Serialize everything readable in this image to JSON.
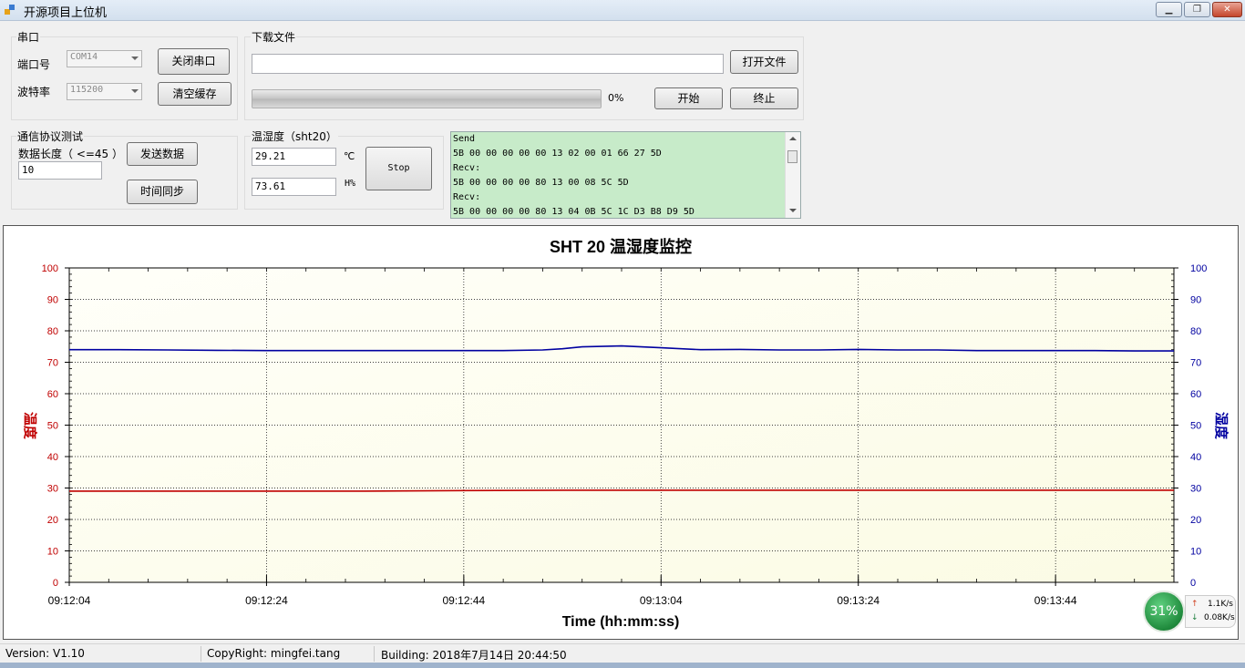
{
  "window": {
    "title": "开源项目上位机"
  },
  "serial": {
    "group_label": "串口",
    "port_label": "端口号",
    "port_value": "COM14",
    "baud_label": "波特率",
    "baud_value": "115200",
    "close_button": "关闭串口",
    "clear_button": "清空缓存"
  },
  "download": {
    "group_label": "下载文件",
    "file_path": "",
    "open_button": "打开文件",
    "progress_text": "0%",
    "progress_value": 0,
    "start_button": "开始",
    "stop_button": "终止"
  },
  "protocol": {
    "group_label": "通信协议测试",
    "length_label": "数据长度（ <=45 ）",
    "length_value": "10",
    "send_button": "发送数据",
    "sync_button": "时间同步"
  },
  "sensor": {
    "group_label": "温湿度（sht20）",
    "temperature": "29.21",
    "temp_unit": "℃",
    "humidity": "73.61",
    "hum_unit": "H%",
    "stop_button": "Stop"
  },
  "log": {
    "lines": [
      "Send",
      "5B 00 00 00 00 00 13 02 00 01 66 27 5D",
      "Recv:",
      "5B 00 00 00 00 80 13 00 08 5C 5D",
      "Recv:",
      "5B 00 00 00 00 80 13 04 0B 5C 1C D3 B8 D9 5D"
    ]
  },
  "chart_data": {
    "type": "line",
    "title": "SHT 20 温湿度监控",
    "xlabel": "Time (hh:mm:ss)",
    "ylabel": "温度",
    "y2label": "湿度",
    "ylim": [
      0,
      100
    ],
    "y2lim": [
      0,
      100
    ],
    "yticks": [
      0,
      10,
      20,
      30,
      40,
      50,
      60,
      70,
      80,
      90,
      100
    ],
    "xticks": [
      "09:12:04",
      "09:12:24",
      "09:12:44",
      "09:13:04",
      "09:13:24",
      "09:13:44"
    ],
    "xlim_seconds": [
      0,
      112
    ],
    "grid": true,
    "series": [
      {
        "axis": "left",
        "color": "#c00000",
        "x": [
          0,
          10,
          20,
          30,
          40,
          50,
          60,
          70,
          80,
          90,
          100,
          112
        ],
        "values": [
          29.0,
          29.0,
          29.0,
          29.0,
          29.2,
          29.3,
          29.3,
          29.3,
          29.3,
          29.3,
          29.3,
          29.3
        ]
      },
      {
        "axis": "right",
        "color": "#0000a0",
        "x": [
          0,
          5,
          10,
          15,
          20,
          25,
          30,
          35,
          40,
          44,
          48,
          50,
          52,
          56,
          60,
          64,
          68,
          72,
          76,
          80,
          84,
          88,
          92,
          96,
          100,
          104,
          108,
          112
        ],
        "values": [
          74.0,
          74.0,
          73.9,
          73.8,
          73.7,
          73.7,
          73.7,
          73.7,
          73.7,
          73.7,
          73.9,
          74.3,
          74.9,
          75.2,
          74.6,
          74.0,
          74.1,
          73.9,
          73.9,
          74.1,
          73.9,
          73.9,
          73.7,
          73.7,
          73.7,
          73.7,
          73.6,
          73.6
        ]
      }
    ]
  },
  "status": {
    "version": "Version: V1.10",
    "copyright": "CopyRight: mingfei.tang",
    "building": "Building: 2018年7月14日 20:44:50"
  },
  "net": {
    "cpu": "31%",
    "up": "1.1K/s",
    "down": "0.08K/s",
    "up_color": "#d04020",
    "down_color": "#208040"
  }
}
